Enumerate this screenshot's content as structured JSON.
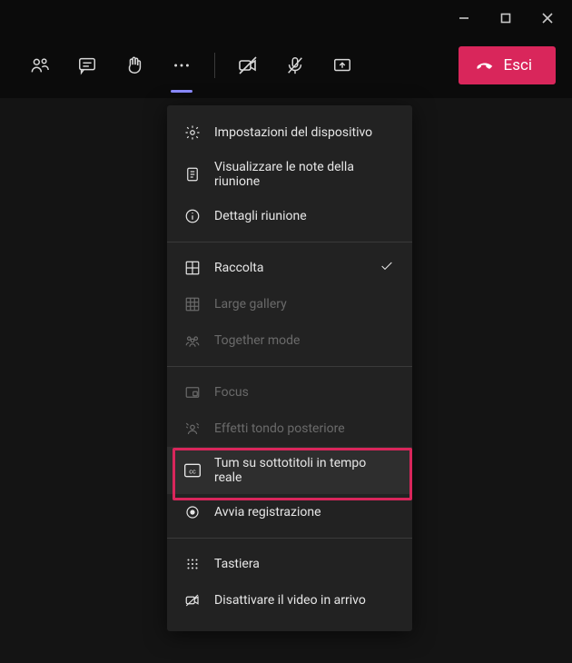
{
  "window": {
    "minimize": "minimize",
    "maximize": "maximize",
    "close": "close"
  },
  "toolbar": {
    "leave_label": "Esci"
  },
  "menu": {
    "section1": {
      "device_settings": "Impostazioni del dispositivo",
      "meeting_notes": "Visualizzare le note della riunione",
      "meeting_details": "Dettagli riunione"
    },
    "section2": {
      "gallery": "Raccolta",
      "large_gallery": "Large gallery",
      "together_mode": "Together mode"
    },
    "section3": {
      "focus": "Focus",
      "background_effects": "Effetti tondo posteriore",
      "live_captions": "Tum su sottotitoli in tempo reale",
      "start_recording": "Avvia registrazione"
    },
    "section4": {
      "keypad": "Tastiera",
      "incoming_video_off": "Disattivare il video in arrivo"
    }
  }
}
